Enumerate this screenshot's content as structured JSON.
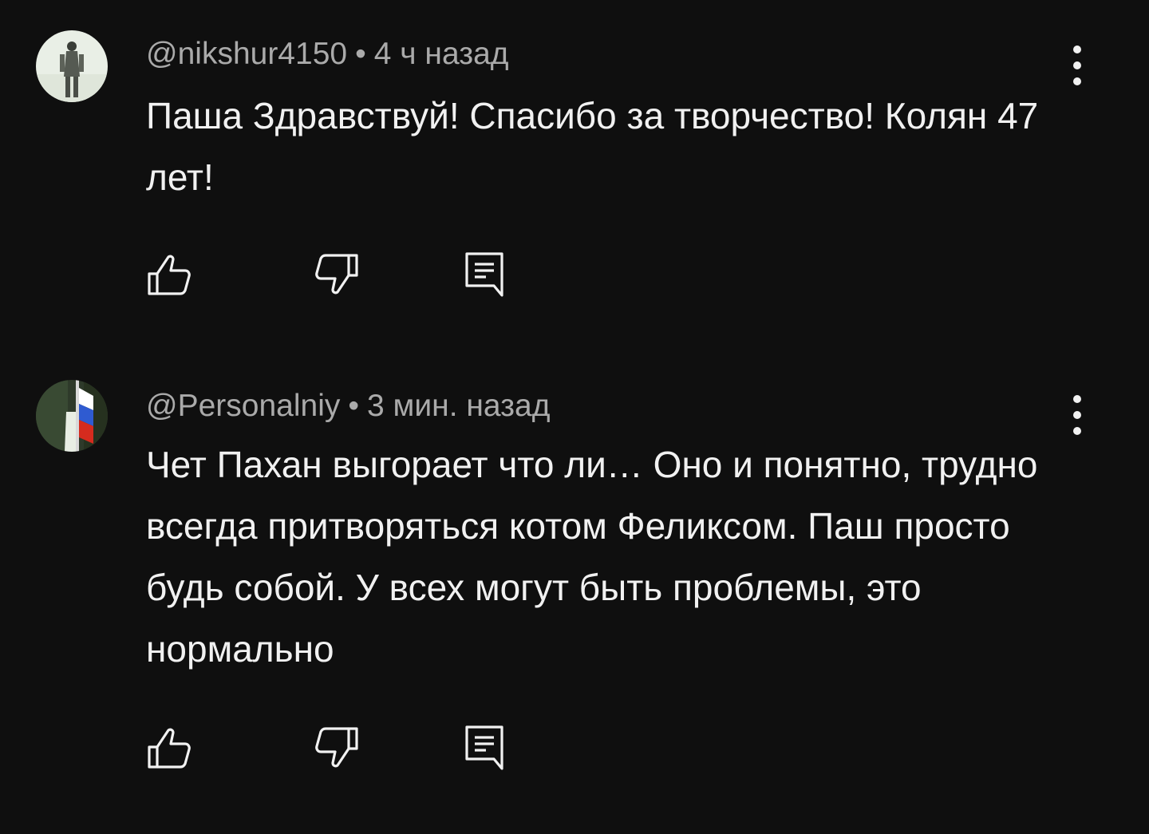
{
  "comments": [
    {
      "author": "@nikshur4150",
      "separator": "•",
      "time": "4 ч назад",
      "text": "Паша Здравствуй! Спасибо за творчество! Колян 47 лет!",
      "icons": {
        "like": "thumbs-up-icon",
        "dislike": "thumbs-down-icon",
        "reply": "reply-comment-icon",
        "menu": "more-vertical-icon"
      }
    },
    {
      "author": "@Personalniy",
      "separator": "•",
      "time": "3 мин. назад",
      "text": "Чет Пахан выгорает что ли… Оно и понятно, трудно всегда притворяться котом Феликсом. Паш просто будь собой. У всех могут быть проблемы, это нормально",
      "icons": {
        "like": "thumbs-up-icon",
        "dislike": "thumbs-down-icon",
        "reply": "reply-comment-icon",
        "menu": "more-vertical-icon"
      }
    }
  ],
  "colors": {
    "background": "#0f0f0f",
    "text": "#f1f1f1",
    "meta": "#aaaaaa"
  }
}
